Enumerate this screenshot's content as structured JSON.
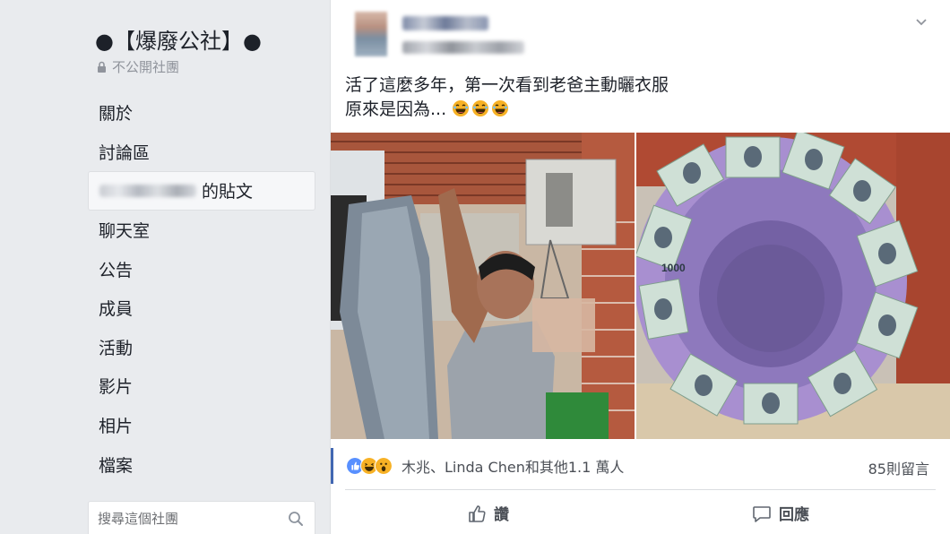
{
  "sidebar": {
    "group_name": "●【爆廢公社】●",
    "privacy": "不公開社團",
    "items": [
      {
        "label": "關於"
      },
      {
        "label": "討論區"
      },
      {
        "label": "的貼文"
      },
      {
        "label": "聊天室"
      },
      {
        "label": "公告"
      },
      {
        "label": "成員"
      },
      {
        "label": "活動"
      },
      {
        "label": "影片"
      },
      {
        "label": "相片"
      },
      {
        "label": "檔案"
      }
    ],
    "search_placeholder": "搜尋這個社團"
  },
  "post": {
    "text_line1": "活了這麼多年，第一次看到老爸主動曬衣服",
    "text_line2": "原來是因為...",
    "reactions_text": "木兆、Linda Chen和其他1.1 萬人",
    "comments_count": "85則留言",
    "like_label": "讚",
    "comment_label": "回應",
    "banknote_value": "1000"
  },
  "colors": {
    "accent": "#4267b2",
    "like_blue": "#5890ff",
    "haha_yellow": "#f7b125"
  },
  "icons": [
    "lock-icon",
    "search-icon",
    "chevron-down-icon",
    "like-icon",
    "comment-icon",
    "laugh-emoji-icon",
    "like-reaction-icon",
    "haha-reaction-icon",
    "wow-reaction-icon"
  ]
}
